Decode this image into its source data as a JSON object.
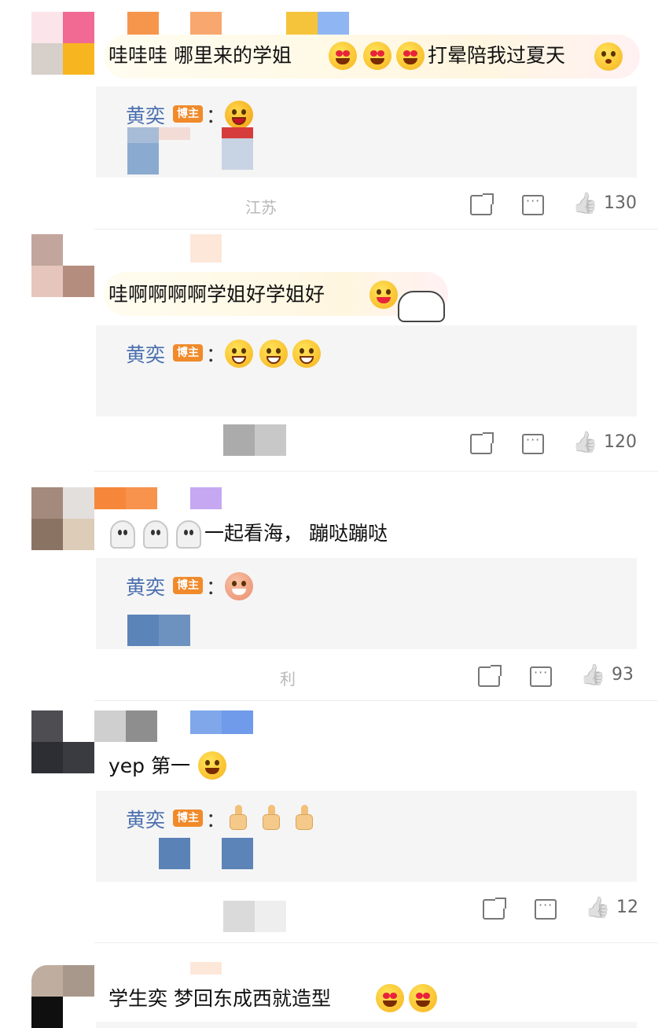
{
  "comments": [
    {
      "text": "哇哇哇 哪里来的学姐",
      "text_after": "打晕陪我过夏天",
      "reply_author": "黄奕",
      "reply_badge": "博主",
      "reply_colon": "：",
      "location": "江苏",
      "likes": "130"
    },
    {
      "text": "哇啊啊啊啊学姐好学姐好",
      "reply_author": "黄奕",
      "reply_badge": "博主",
      "reply_colon": "：",
      "likes": "120"
    },
    {
      "text": "一起看海， 蹦哒蹦哒",
      "reply_author": "黄奕",
      "reply_badge": "博主",
      "reply_colon": "：",
      "location": "利",
      "likes": "93"
    },
    {
      "text": "yep 第一",
      "reply_author": "黄奕",
      "reply_badge": "博主",
      "reply_colon": "：",
      "likes": "12"
    },
    {
      "text": "学生奕 梦回东成西就造型"
    }
  ],
  "icons": [
    "share-icon",
    "comment-icon",
    "like-icon",
    "emoji-icon",
    "ghost-icon",
    "thumbs-up-icon"
  ],
  "colors": {
    "author": "#4a6fae",
    "badge": "#f08a2a",
    "reply_bg": "#f5f5f5",
    "count": "#666666"
  }
}
